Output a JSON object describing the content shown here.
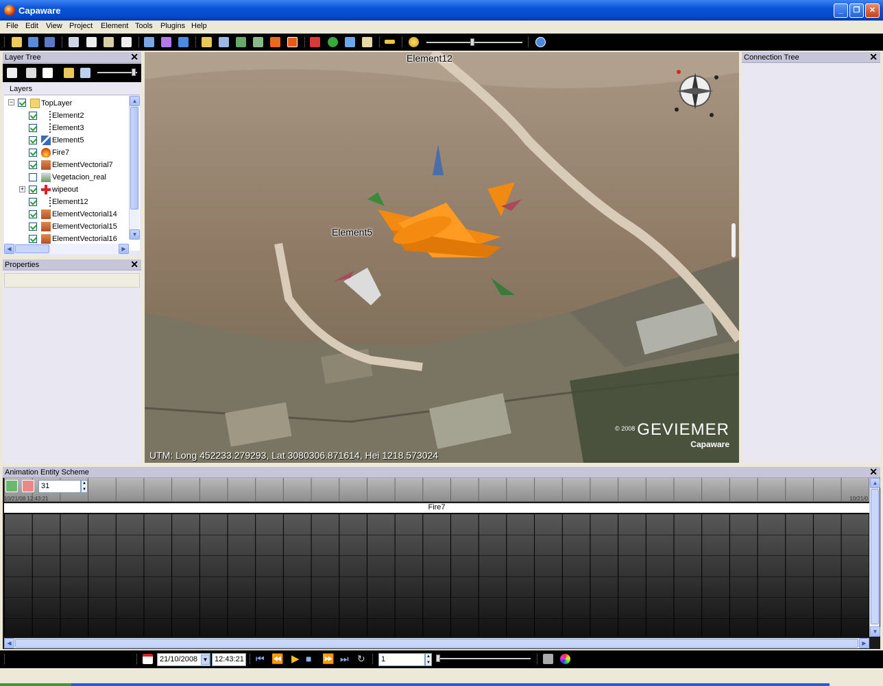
{
  "window": {
    "title": "Capaware",
    "min": "_",
    "max": "❐",
    "close": "✕"
  },
  "menu": [
    "File",
    "Edit",
    "View",
    "Project",
    "Element",
    "Tools",
    "Plugins",
    "Help"
  ],
  "layer_tree": {
    "title": "Layer Tree",
    "tab": "Layers",
    "root": "TopLayer",
    "items": [
      {
        "label": "Element2",
        "checked": true,
        "icon": "dotted-line-icon"
      },
      {
        "label": "Element3",
        "checked": true,
        "icon": "dotted-line-icon"
      },
      {
        "label": "Element5",
        "checked": true,
        "icon": "plane-icon"
      },
      {
        "label": "Fire7",
        "checked": true,
        "icon": "fire-icon"
      },
      {
        "label": "ElementVectorial7",
        "checked": true,
        "icon": "vector-icon"
      },
      {
        "label": "Vegetacion_real",
        "checked": false,
        "icon": "vegetation-icon"
      },
      {
        "label": "wipeout",
        "checked": true,
        "icon": "red-cross-icon"
      },
      {
        "label": "Element12",
        "checked": true,
        "icon": "dotted-line-icon"
      },
      {
        "label": "ElementVectorial14",
        "checked": true,
        "icon": "vector-icon"
      },
      {
        "label": "ElementVectorial15",
        "checked": true,
        "icon": "vector-icon"
      },
      {
        "label": "ElementVectorial16",
        "checked": true,
        "icon": "vector-icon"
      }
    ]
  },
  "properties": {
    "title": "Properties"
  },
  "connection_tree": {
    "title": "Connection Tree"
  },
  "viewport": {
    "label_top": "Element12",
    "label_plane": "Element5",
    "utm": "UTM: Long 452233.279293, Lat 3080306.871614, Hei 1218.573024",
    "copyright": "© 2008",
    "brand": "GEVIEMER",
    "brand2": "Capaware"
  },
  "animation": {
    "title": "Animation Entity Scheme",
    "spin_value": "31",
    "time_start": "10/21/08 12:43:21",
    "time_end": "10/21/0",
    "track": "Fire7"
  },
  "playback": {
    "date": "21/10/2008",
    "time": "12:43:21",
    "speed": "1"
  }
}
